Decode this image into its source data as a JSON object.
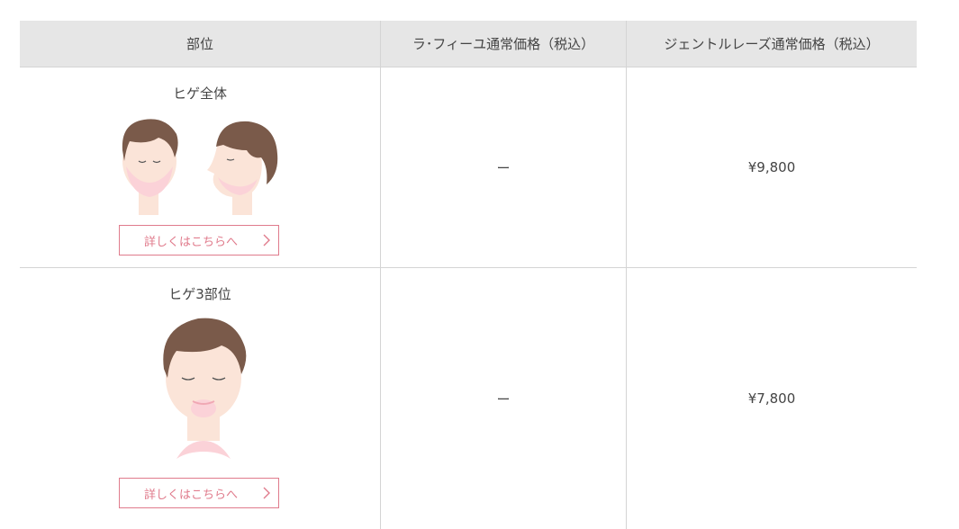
{
  "header": {
    "col_part": "部位",
    "col_lafiu": "ラ･フィーユ通常価格（税込）",
    "col_gentle": "ジェントルレーズ通常価格（税込）"
  },
  "rows": [
    {
      "part": "ヒゲ全体",
      "lafiu_price": "ー",
      "gentle_price": "¥9,800",
      "more_label": "詳しくはこちらへ"
    },
    {
      "part": "ヒゲ3部位",
      "lafiu_price": "ー",
      "gentle_price": "¥7,800",
      "more_label": "詳しくはこちらへ"
    }
  ],
  "icons": {
    "chevron": "chevron-right-icon"
  },
  "colors": {
    "accent": "#e07b8c",
    "header_bg": "#e6e6e6",
    "hair": "#7a5a4a",
    "skin": "#fbe4d8",
    "highlight": "#fbd2d8"
  }
}
